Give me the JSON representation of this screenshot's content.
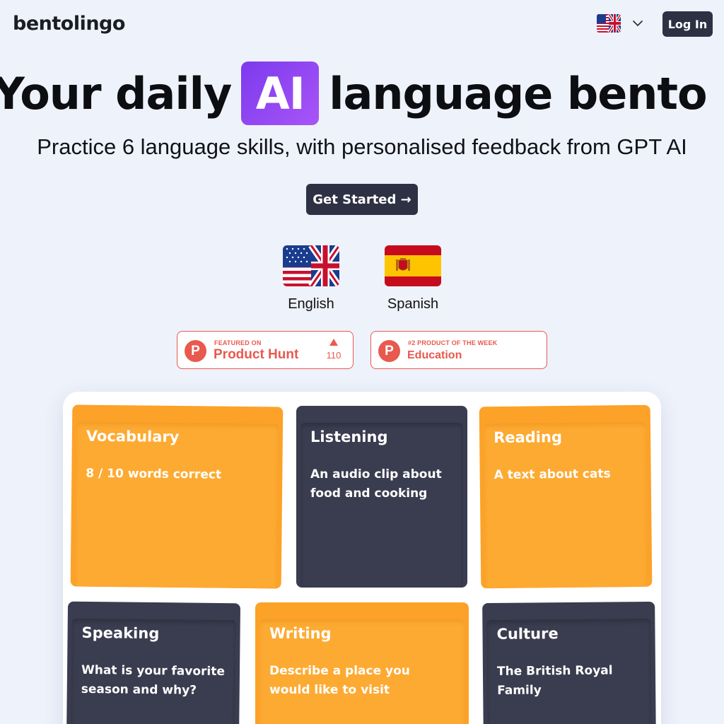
{
  "header": {
    "logo": "bentolingo",
    "language_picker": {
      "flag_icon": "uk-us-flag-icon",
      "chevron_icon": "chevron-down-icon"
    },
    "login_label": "Log In"
  },
  "hero": {
    "title_before": "Your daily",
    "title_badge": "AI",
    "title_after": "language bento box",
    "subtitle": "Practice 6 language skills, with personalised feedback from GPT AI",
    "cta_label": "Get Started →"
  },
  "languages": [
    {
      "name": "English",
      "flag_icon": "uk-us-flag-icon"
    },
    {
      "name": "Spanish",
      "flag_icon": "spain-flag-icon"
    }
  ],
  "badges": [
    {
      "top": "FEATURED ON",
      "main": "Product Hunt",
      "votes": "110"
    },
    {
      "top": "#2 PRODUCT OF THE WEEK",
      "main": "Education"
    }
  ],
  "bento": [
    {
      "title": "Vocabulary",
      "desc": "8 / 10 words correct",
      "color": "#fca228"
    },
    {
      "title": "Listening",
      "desc": "An audio clip about food and cooking",
      "color": "#3a3c50"
    },
    {
      "title": "Reading",
      "desc": "A text about cats",
      "color": "#fca228"
    },
    {
      "title": "Speaking",
      "desc": "What is your favorite season and why?",
      "color": "#3a3c50"
    },
    {
      "title": "Writing",
      "desc": "Describe a place you would like to visit",
      "color": "#fca228"
    },
    {
      "title": "Culture",
      "desc": "The British Royal Family",
      "color": "#3a3c50"
    }
  ],
  "colors": {
    "background": "#eef2fb",
    "dark_button": "#2e3044",
    "accent_purple": "#7c3aed",
    "product_hunt": "#e8594f",
    "orange_card": "#fca228",
    "dark_card": "#3a3c50"
  }
}
